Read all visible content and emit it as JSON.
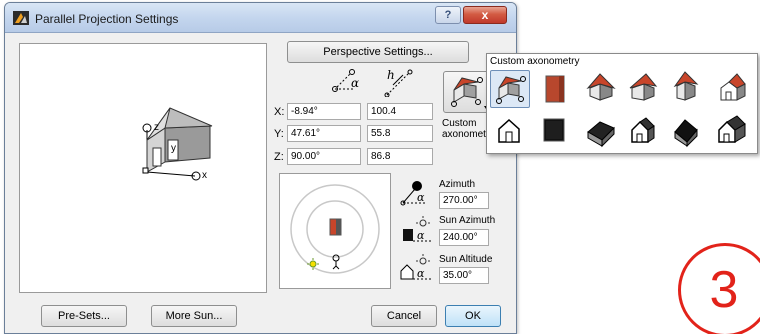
{
  "window": {
    "title": "Parallel Projection Settings",
    "help_label": "?",
    "close_label": "x"
  },
  "buttons": {
    "perspective": "Perspective Settings...",
    "presets": "Pre-Sets...",
    "more_sun": "More Sun...",
    "cancel": "Cancel",
    "ok": "OK"
  },
  "projection": {
    "rows": [
      {
        "axis": "X:",
        "angle": "-8.94°",
        "length": "100.4"
      },
      {
        "axis": "Y:",
        "angle": "47.61°",
        "length": "55.8"
      },
      {
        "axis": "Z:",
        "angle": "90.00°",
        "length": "86.8"
      }
    ],
    "angle_header_symbol": "α",
    "length_header_symbol": "h",
    "custom_label_line1": "Custom",
    "custom_label_line2": "axonometr"
  },
  "sun": {
    "azimuth_label": "Azimuth",
    "azimuth_value": "270.00°",
    "sun_azimuth_label": "Sun Azimuth",
    "sun_azimuth_value": "240.00°",
    "sun_altitude_label": "Sun Altitude",
    "sun_altitude_value": "35.00°",
    "alpha_symbol": "α"
  },
  "preview_axes": {
    "x": "x",
    "y": "y",
    "z": "z"
  },
  "popup": {
    "title": "Custom axonometry",
    "items": [
      {
        "icon": "custom-axonometry-icon",
        "selected": true
      },
      {
        "icon": "front-elevation-brick-icon"
      },
      {
        "icon": "isometric-house-red-roof-icon"
      },
      {
        "icon": "dimetric-house-red-roof-icon"
      },
      {
        "icon": "trimetric-house-red-roof-icon"
      },
      {
        "icon": "oblique-house-red-roof-icon"
      },
      {
        "icon": "elevation-house-outline-icon"
      },
      {
        "icon": "top-view-dark-square-icon"
      },
      {
        "icon": "plan-oblique-dark-icon"
      },
      {
        "icon": "cavalier-house-outline-icon"
      },
      {
        "icon": "cabinet-house-dark-icon"
      },
      {
        "icon": "planometric-house-outline-icon"
      }
    ]
  },
  "badge": {
    "number": "3"
  },
  "colors": {
    "accent_red": "#e2231a",
    "roof_red": "#c8452a",
    "brick": "#b8472d"
  }
}
